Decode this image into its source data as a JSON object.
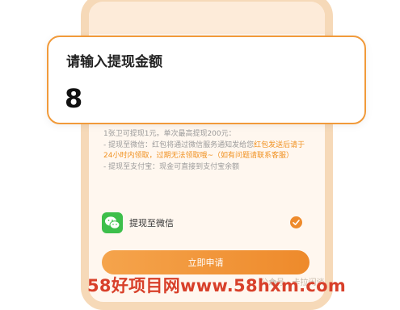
{
  "amount_card": {
    "title": "请输入提现金额",
    "amount_value": "8"
  },
  "rules": {
    "line1": "1张卫可提现1元。单次最高提现200元：",
    "line2_prefix": "- 提现至微信：红包将通过微信服务通知发给您",
    "line2_highlight": "红包发送后请于24小时内领取，过期无法领取哦~（如有问题请联系客服）",
    "line3": "- 提现至支付宝：现金可直接到支付宝余额"
  },
  "withdraw_option": {
    "label": "提现至微信",
    "selected": true,
    "icon": "wechat-icon",
    "color": "#3dbf4b"
  },
  "submit": {
    "label": "立即申请"
  },
  "watermark": {
    "site": "58好项目网www.58hxm.com",
    "account": "公众号 · 卡拉闲谈"
  },
  "colors": {
    "accent": "#ee8a2b",
    "highlight_text": "#f0901f",
    "watermark_red": "#d8402a"
  }
}
